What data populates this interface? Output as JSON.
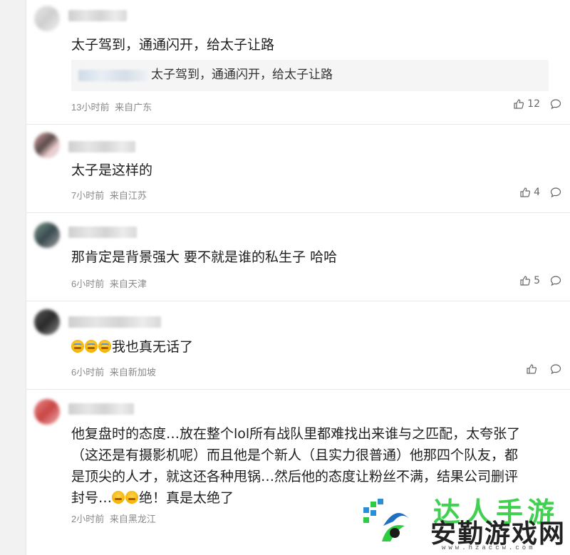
{
  "comments": [
    {
      "text": "太子驾到，通通闪开，给太子让路",
      "quote": "太子驾到，通通闪开，给太子让路",
      "time": "13小时前",
      "location": "来自广东",
      "likes": "12"
    },
    {
      "text": "太子是这样的",
      "time": "7小时前",
      "location": "来自江苏",
      "likes": "4"
    },
    {
      "text": "那肯定是背景强大 要不就是谁的私生子 哈哈",
      "time": "6小时前",
      "location": "来自天津",
      "likes": "5"
    },
    {
      "text": "我也真无话了",
      "time": "6小时前",
      "location": "来自新加坡",
      "likes": ""
    },
    {
      "text_line1": "他复盘时的态度…放在整个lol所有战队里都难找出来谁与之匹配，太夸张了",
      "text_line2": "（这还是有摄影机呢）而且他是个新人（且实力很普通）他那四个队友，都",
      "text_line3": "是顶尖的人才，就这还各种甩锅…然后他的态度让粉丝不满，结果公司删评",
      "text_line4a": "封号…",
      "text_line4b": "绝！真是太绝了",
      "time": "2小时前",
      "location": "来自黑龙江"
    }
  ],
  "watermark": {
    "top": "达人手游",
    "main": "安勤游戏网",
    "url": "www.hzaccw.com"
  },
  "colors": {
    "accent": "#2ecc40",
    "meta": "#8a8a8a"
  }
}
